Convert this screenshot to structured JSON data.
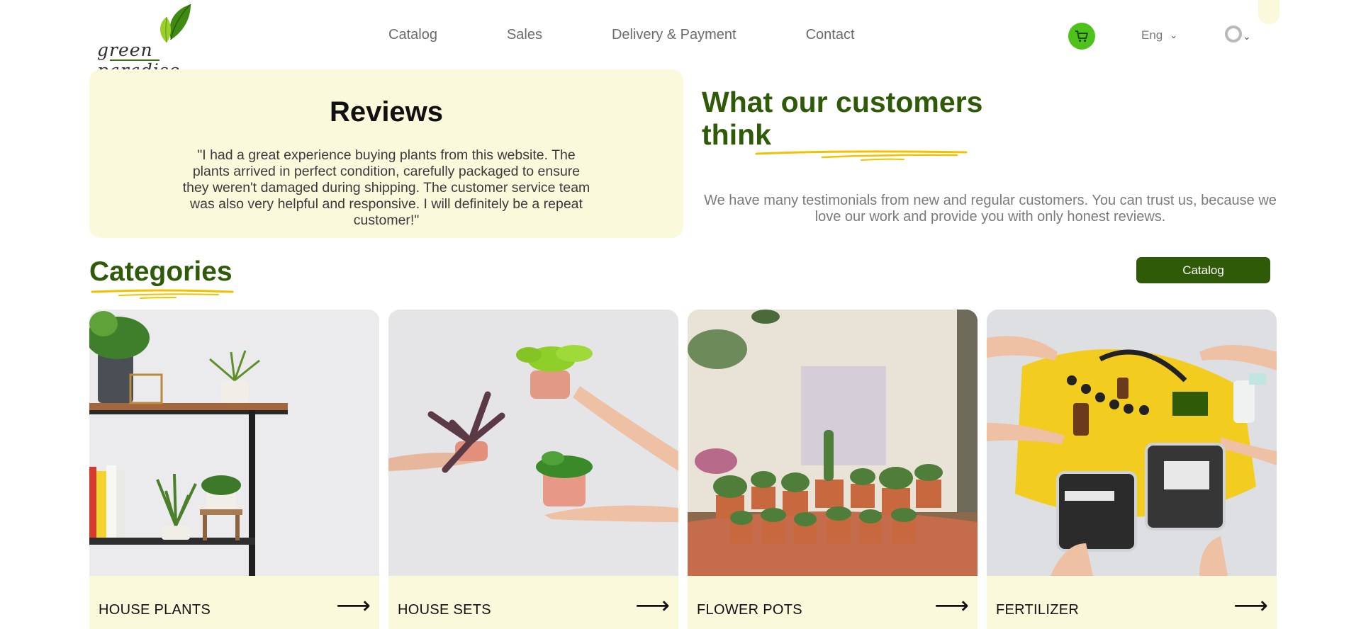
{
  "logo": {
    "text": "green paradise"
  },
  "nav": {
    "items": [
      "Catalog",
      "Sales",
      "Delivery & Payment",
      "Contact"
    ]
  },
  "header": {
    "language": "Eng",
    "cart_icon": "cart-icon",
    "user_icon": "user-icon"
  },
  "reviews": {
    "title": "Reviews",
    "quote": "\"I had a great experience buying plants from this website. The plants arrived in perfect condition, carefully packaged to ensure they weren't damaged during shipping. The customer service team was also very helpful and responsive. I will definitely be a repeat customer!\""
  },
  "testimonials": {
    "title_line1": "What our customers",
    "title_line2": "think",
    "text": "We have many testimonials from new and regular customers. You can trust us, because we love our work and provide you with only honest reviews."
  },
  "categories": {
    "title": "Categories",
    "catalog_button": "Catalog",
    "items": [
      {
        "label": "HOUSE PLANTS",
        "arrow": "⟶"
      },
      {
        "label": "HOUSE SETS",
        "arrow": "⟶"
      },
      {
        "label": "FLOWER POTS",
        "arrow": "⟶"
      },
      {
        "label": "FERTILIZER",
        "arrow": "⟶"
      }
    ]
  },
  "colors": {
    "brand_green": "#2f5a07",
    "cart_green": "#4cc21a",
    "cream": "#fbf9dc",
    "accent_yellow": "#f2c200"
  }
}
